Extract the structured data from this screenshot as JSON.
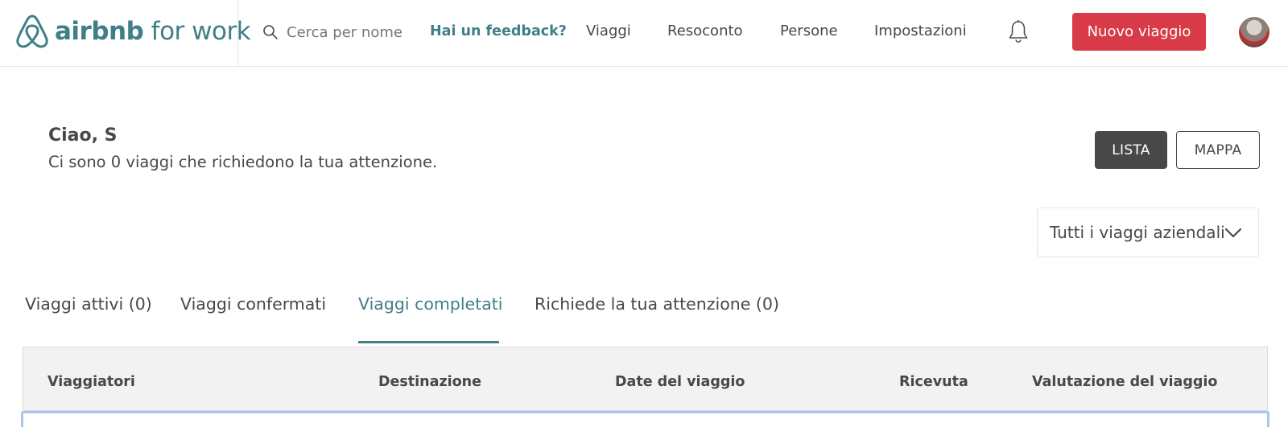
{
  "header": {
    "logo": {
      "word_bold": "airbnb",
      "word_light": " for work"
    },
    "search": {
      "placeholder": "Cerca per nome o",
      "value": ""
    },
    "feedback_link": "Hai un feedback?",
    "nav": {
      "viaggi": "Viaggi",
      "resoconto": "Resoconto",
      "persone": "Persone",
      "impostazioni": "Impostazioni"
    },
    "icons": {
      "search": "search-icon",
      "notifications": "bell-icon",
      "avatar": "user-avatar"
    },
    "new_trip_button": "Nuovo viaggio"
  },
  "main": {
    "greeting": "Ciao, S",
    "attention_message": "Ci sono 0 viaggi che richiedono la tua attenzione.",
    "view_toggle": {
      "list": "LISTA",
      "map": "MAPPA",
      "selected": "LISTA"
    },
    "filter": {
      "selected": "Tutti i viaggi aziendali",
      "icon": "chevron-down-icon"
    },
    "tabs": [
      {
        "label": "Viaggi attivi (0)",
        "active": false
      },
      {
        "label": "Viaggi confermati",
        "active": false
      },
      {
        "label": "Viaggi completati",
        "active": true
      },
      {
        "label": "Richiede la tua attenzione (0)",
        "active": false
      }
    ],
    "table": {
      "columns": [
        "Viaggiatori",
        "Destinazione",
        "Date del viaggio",
        "Ricevuta",
        "Valutazione del viaggio"
      ]
    }
  },
  "colors": {
    "brand_teal": "#3f7f86",
    "primary_red": "#d93a47",
    "dark_button": "#484848",
    "text": "#484848",
    "table_header_bg": "#f2f2f2",
    "focus_outline": "#a9c6ee"
  }
}
